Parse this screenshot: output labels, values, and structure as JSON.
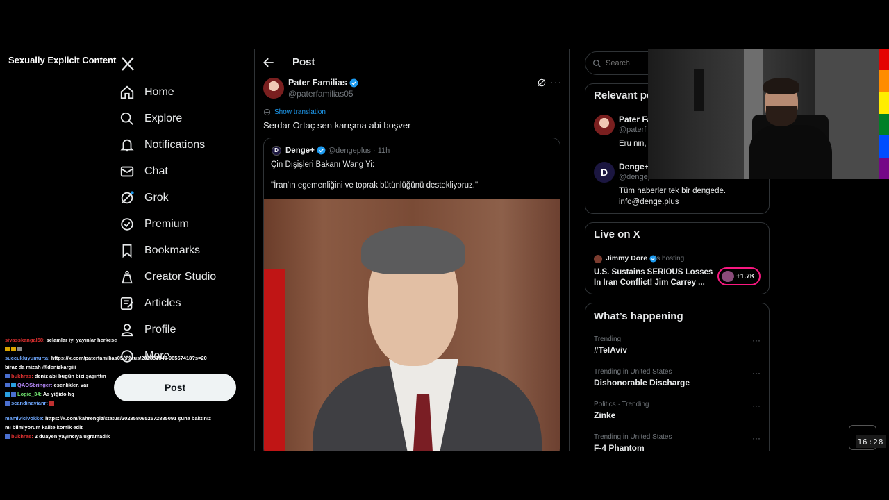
{
  "overlay": {
    "explicit_label": "Sexually Explicit Content",
    "clock": "16:28"
  },
  "nav": {
    "logo_icon": "x-logo-icon",
    "items": [
      {
        "label": "Home",
        "icon": "home-icon"
      },
      {
        "label": "Explore",
        "icon": "search-icon"
      },
      {
        "label": "Notifications",
        "icon": "bell-icon"
      },
      {
        "label": "Chat",
        "icon": "mail-icon"
      },
      {
        "label": "Grok",
        "icon": "grok-icon"
      },
      {
        "label": "Premium",
        "icon": "premium-icon"
      },
      {
        "label": "Bookmarks",
        "icon": "bookmark-icon"
      },
      {
        "label": "Creator Studio",
        "icon": "creator-icon"
      },
      {
        "label": "Articles",
        "icon": "articles-icon"
      },
      {
        "label": "Profile",
        "icon": "person-icon"
      },
      {
        "label": "More",
        "icon": "more-icon"
      }
    ],
    "post_button": "Post"
  },
  "main": {
    "title": "Post",
    "author": {
      "name": "Pater Familias",
      "handle": "@paterfamilias05"
    },
    "show_translation": "Show translation",
    "text": "Serdar Ortaç sen karışma abi boşver",
    "quote": {
      "name": "Denge+",
      "handle_time": "@dengeplus · 11h",
      "line1": "Çin Dışişleri Bakanı Wang Yi:",
      "line2": "\"İran'ın egemenliğini ve toprak bütünlüğünü destekliyoruz.\""
    }
  },
  "right": {
    "search_placeholder": "Search",
    "relevant": {
      "title": "Relevant people",
      "people": [
        {
          "name": "Pater Fa",
          "handle": "@paterf",
          "bio": "Eru nin,"
        },
        {
          "name": "Denge+",
          "handle": "@dengeplus",
          "bio": "Tüm haberler tek bir dengede. info@denge.plus"
        }
      ]
    },
    "live": {
      "title": "Live on X",
      "host": "Jimmy Dore",
      "hosting": "is hosting",
      "stream_title": "U.S. Sustains SERIOUS Losses In Iran Conflict! Jim Carrey ...",
      "count": "+1.7K"
    },
    "happening": {
      "title": "What’s happening",
      "trends": [
        {
          "context": "Trending",
          "title": "#TelAviv"
        },
        {
          "context": "Trending in United States",
          "title": "Dishonorable Discharge"
        },
        {
          "context": "Politics · Trending",
          "title": "Zinke"
        },
        {
          "context": "Trending in United States",
          "title": "F-4 Phantom"
        }
      ]
    }
  },
  "chat": [
    {
      "user": "sivasskangal58",
      "text": "selamlar iyi yayınlar herkese"
    },
    {
      "user": "succukluyumurta",
      "text": "https://x.com/paterfamilias05/status/202851848 96557418?s=20 biraz da mizah @denizkargiii"
    },
    {
      "user": "bukhras",
      "text": "deniz abi bugün bizi şaşırttın"
    },
    {
      "user": "QAOSbringer",
      "text": "esenlikler, var"
    },
    {
      "user": "Logic_34",
      "text": "As yiğido hg"
    },
    {
      "user": "scandinavianr",
      "text": ""
    },
    {
      "user": "mamivicivokke",
      "text": "https://x.com/kahrengiz/status/2028580652572885091 şuna baktınız mı bilmiyorum kalite komik edit"
    },
    {
      "user": "bukhras",
      "text": "2 duayen yayıncıya ugramadık"
    }
  ],
  "colors": {
    "accent": "#1d9bf0",
    "live": "#f91880",
    "background": "#000000"
  }
}
